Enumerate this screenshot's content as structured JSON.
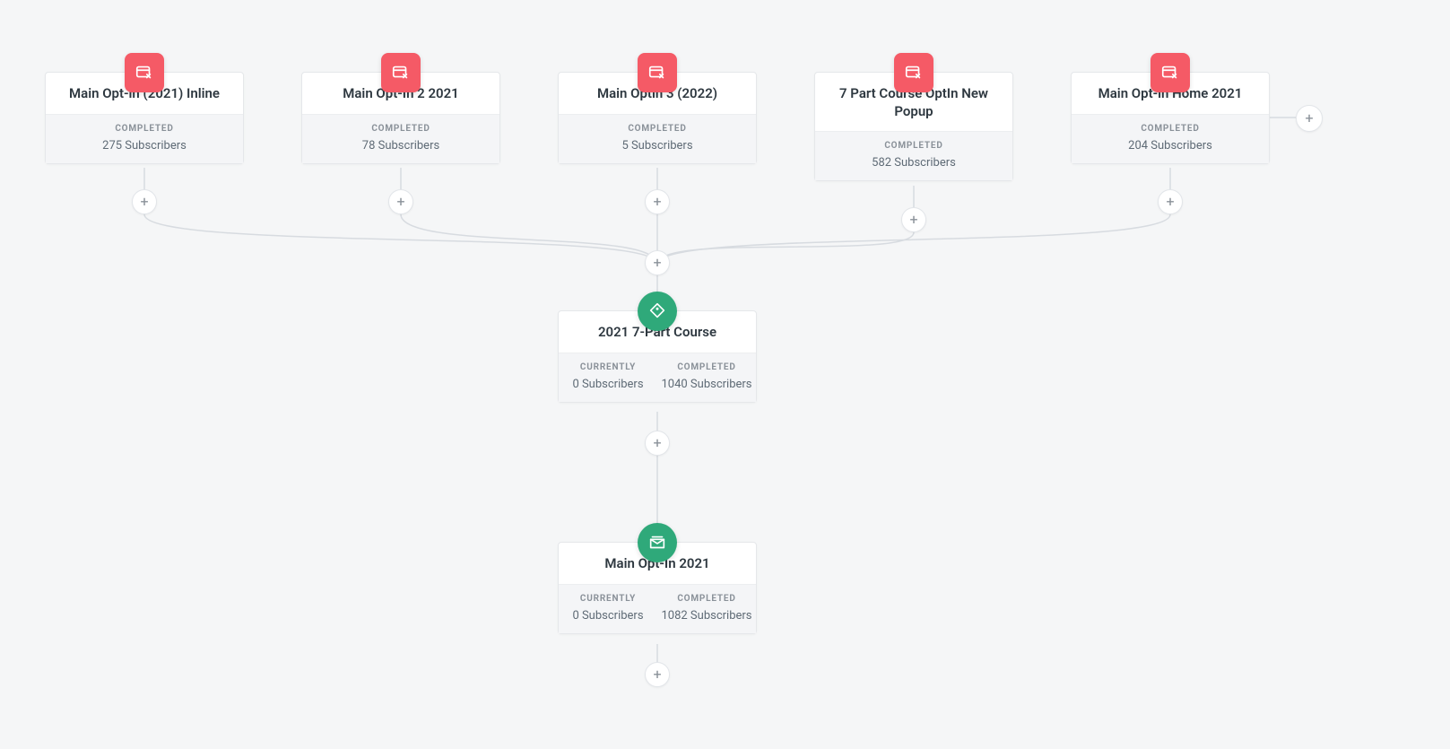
{
  "labels": {
    "completed": "COMPLETED",
    "currently": "CURRENTLY"
  },
  "nodes": {
    "form1": {
      "title": "Main Opt-in (2021) Inline",
      "completed_count": "275 Subscribers"
    },
    "form2": {
      "title": "Main Opt-In 2 2021",
      "completed_count": "78 Subscribers"
    },
    "form3": {
      "title": "Main Optin 3 (2022)",
      "completed_count": "5 Subscribers"
    },
    "form4": {
      "title": "7 Part Course OptIn New Popup",
      "completed_count": "582 Subscribers"
    },
    "form5": {
      "title": "Main Opt-in Home 2021",
      "completed_count": "204 Subscribers"
    },
    "seq1": {
      "title": "2021 7-Part Course",
      "currently": "0 Subscribers",
      "completed": "1040 Subscribers"
    },
    "seq2": {
      "title": "Main Opt-In 2021",
      "currently": "0 Subscribers",
      "completed": "1082 Subscribers"
    }
  }
}
